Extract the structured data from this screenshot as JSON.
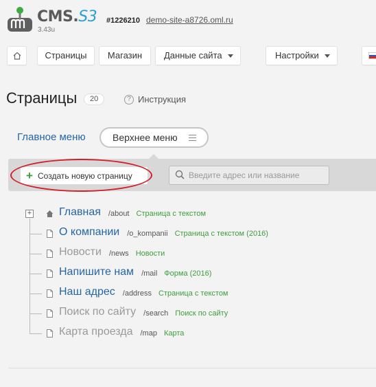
{
  "header": {
    "logo_text": "CMS.",
    "logo_suffix": "S3",
    "version": "3.43u",
    "site_id": "#1226210",
    "site_domain": "demo-site-a8726.oml.ru"
  },
  "nav": {
    "home_icon": "home-icon",
    "items": [
      "Страницы",
      "Магазин",
      "Данные сайта",
      "Настройки"
    ],
    "language_icon": "russian-flag-icon"
  },
  "page": {
    "title": "Страницы",
    "count": "20",
    "help_label": "Инструкция",
    "help_icon": "?"
  },
  "menus": {
    "main_tab": "Главное меню",
    "top_tab": "Верхнее меню"
  },
  "toolbar": {
    "create_icon": "+",
    "create_label": "Создать новую страницу",
    "search_placeholder": "Введите адрес или название"
  },
  "tree": {
    "expand_symbol": "+",
    "rows": [
      {
        "title": "Главная",
        "path": "/about",
        "type": "Страница с текстом",
        "active": true,
        "icon": "home-icon"
      },
      {
        "title": "О компании",
        "path": "/o_kompanii",
        "type": "Страница с текстом (2016)",
        "active": true,
        "icon": "page-icon"
      },
      {
        "title": "Новости",
        "path": "/news",
        "type": "Новости",
        "active": false,
        "icon": "page-icon"
      },
      {
        "title": "Напишите нам",
        "path": "/mail",
        "type": "Форма (2016)",
        "active": true,
        "icon": "page-icon"
      },
      {
        "title": "Наш адрес",
        "path": "/address",
        "type": "Страница с текстом",
        "active": true,
        "icon": "page-icon"
      },
      {
        "title": "Поиск по сайту",
        "path": "/search",
        "type": "Поиск по сайту",
        "active": false,
        "icon": "page-icon"
      },
      {
        "title": "Карта проезда",
        "path": "/map",
        "type": "Карта",
        "active": false,
        "icon": "page-icon"
      }
    ]
  },
  "colors": {
    "link_blue": "#2465a6",
    "type_green": "#3d9e3d",
    "highlight_red": "#d21f28",
    "logo_accent": "#2aa0d6"
  }
}
